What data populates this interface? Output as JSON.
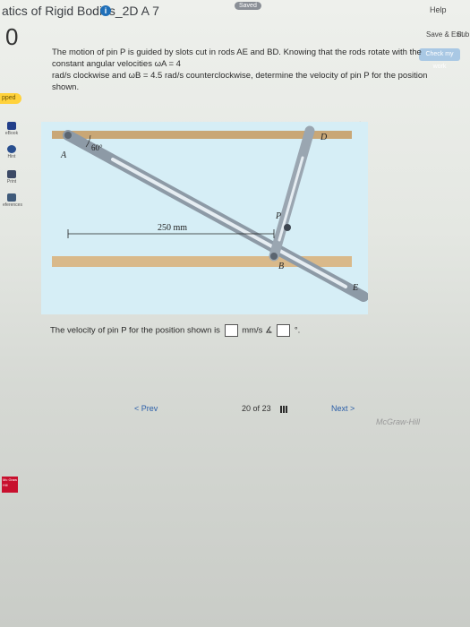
{
  "header": {
    "title": "atics of Rigid Bodies_2D A 7",
    "info_glyph": "i",
    "saved_label": "Saved",
    "help_label": "Help",
    "save_exit_label": "Save & Exit",
    "submit_label": "Sub",
    "check_label": "Check my work"
  },
  "question": {
    "number": "0",
    "text_line1": "The motion of pin P is guided by slots cut in rods AE and BD. Knowing that the rods rotate with the constant angular velocities ωA = 4",
    "text_line2": "rad/s clockwise and ωB = 4.5 rad/s counterclockwise, determine the velocity of pin P for the position shown.",
    "answer_prefix": "The velocity of pin P for the position shown is",
    "answer_unit": "mm/s ∡",
    "answer_suffix": "°."
  },
  "figure": {
    "dimension_label": "250 mm",
    "angle_label": "60°",
    "labels": {
      "A": "A",
      "B": "B",
      "P": "P",
      "D": "D",
      "E": "E"
    }
  },
  "sidebar": {
    "skipped_label": "pped",
    "items": [
      {
        "label": "eBook",
        "icon": "book-icon"
      },
      {
        "label": "Hint",
        "icon": "hint-icon"
      },
      {
        "label": "Print",
        "icon": "print-icon"
      },
      {
        "label": "eferences",
        "icon": "references-icon"
      }
    ],
    "logo_text": "Mc Graw Hill"
  },
  "footer": {
    "prev_label": "< Prev",
    "page_current": "20",
    "page_of": "of",
    "page_total": "23",
    "next_label": "Next >",
    "brand": "McGraw-Hill"
  },
  "colors": {
    "accent": "#1f6fb8",
    "skipped": "#ffd23c",
    "figure_bg": "#d6eef6"
  }
}
